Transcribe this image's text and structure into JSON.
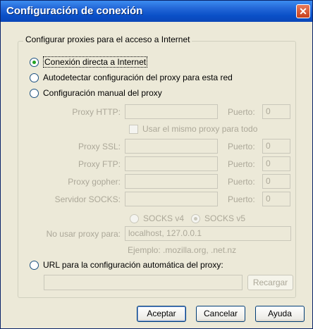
{
  "window": {
    "title": "Configuración de conexión",
    "close_glyph": "✕"
  },
  "group": {
    "legend": "Configurar proxies para el acceso a Internet"
  },
  "options": {
    "direct": "Conexión directa a Internet",
    "autodetect": "Autodetectar configuración del proxy para esta red",
    "manual": "Configuración manual del proxy",
    "auto_url": "URL para la configuración automática del proxy:"
  },
  "selected_option": "direct",
  "manual": {
    "http_label": "Proxy HTTP:",
    "http_value": "",
    "http_port_label": "Puerto:",
    "http_port": "0",
    "same_proxy": "Usar el mismo proxy para todo",
    "ssl_label": "Proxy SSL:",
    "ssl_value": "",
    "ssl_port_label": "Puerto:",
    "ssl_port": "0",
    "ftp_label": "Proxy FTP:",
    "ftp_value": "",
    "ftp_port_label": "Puerto:",
    "ftp_port": "0",
    "gopher_label": "Proxy gopher:",
    "gopher_value": "",
    "gopher_port_label": "Puerto:",
    "gopher_port": "0",
    "socks_label": "Servidor SOCKS:",
    "socks_value": "",
    "socks_port_label": "Puerto:",
    "socks_port": "0",
    "socks_v4": "SOCKS v4",
    "socks_v5": "SOCKS v5",
    "no_proxy_label": "No usar proxy para:",
    "no_proxy_value": "localhost, 127.0.0.1",
    "example": "Ejemplo: .mozilla.org, .net.nz"
  },
  "auto_config": {
    "url_value": "",
    "reload": "Recargar"
  },
  "buttons": {
    "ok": "Aceptar",
    "cancel": "Cancelar",
    "help": "Ayuda"
  }
}
